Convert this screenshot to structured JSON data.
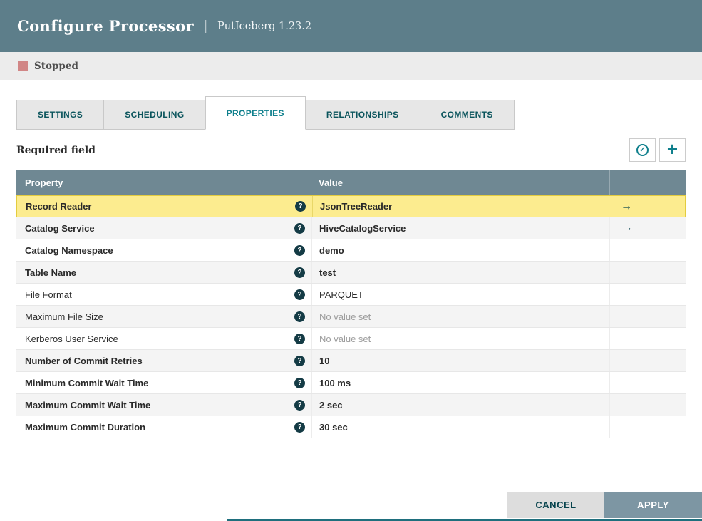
{
  "header": {
    "title": "Configure Processor",
    "separator": "|",
    "subtitle": "PutIceberg 1.23.2"
  },
  "status": {
    "label": "Stopped"
  },
  "tabs": [
    {
      "label": "SETTINGS",
      "active": false
    },
    {
      "label": "SCHEDULING",
      "active": false
    },
    {
      "label": "PROPERTIES",
      "active": true
    },
    {
      "label": "RELATIONSHIPS",
      "active": false
    },
    {
      "label": "COMMENTS",
      "active": false
    }
  ],
  "toolbar": {
    "required_label": "Required field"
  },
  "icons": {
    "help": "?",
    "go_to_service": "→",
    "verify_check": "✓",
    "add_plus": "+"
  },
  "table": {
    "columns": [
      "Property",
      "Value"
    ],
    "rows": [
      {
        "property": "Record Reader",
        "value": "JsonTreeReader",
        "required": true,
        "value_set": true,
        "has_link": true,
        "selected": true
      },
      {
        "property": "Catalog Service",
        "value": "HiveCatalogService",
        "required": true,
        "value_set": true,
        "has_link": true,
        "selected": false
      },
      {
        "property": "Catalog Namespace",
        "value": "demo",
        "required": true,
        "value_set": true,
        "has_link": false,
        "selected": false
      },
      {
        "property": "Table Name",
        "value": "test",
        "required": true,
        "value_set": true,
        "has_link": false,
        "selected": false
      },
      {
        "property": "File Format",
        "value": "PARQUET",
        "required": false,
        "value_set": true,
        "has_link": false,
        "selected": false
      },
      {
        "property": "Maximum File Size",
        "value": "No value set",
        "required": false,
        "value_set": false,
        "has_link": false,
        "selected": false
      },
      {
        "property": "Kerberos User Service",
        "value": "No value set",
        "required": false,
        "value_set": false,
        "has_link": false,
        "selected": false
      },
      {
        "property": "Number of Commit Retries",
        "value": "10",
        "required": true,
        "value_set": true,
        "has_link": false,
        "selected": false
      },
      {
        "property": "Minimum Commit Wait Time",
        "value": "100 ms",
        "required": true,
        "value_set": true,
        "has_link": false,
        "selected": false
      },
      {
        "property": "Maximum Commit Wait Time",
        "value": "2 sec",
        "required": true,
        "value_set": true,
        "has_link": false,
        "selected": false
      },
      {
        "property": "Maximum Commit Duration",
        "value": "30 sec",
        "required": true,
        "value_set": true,
        "has_link": false,
        "selected": false
      }
    ]
  },
  "footer": {
    "cancel_label": "CANCEL",
    "apply_label": "APPLY"
  },
  "colors": {
    "header_bg": "#5d7e8a",
    "table_header_bg": "#6f8893",
    "stopped_color": "#d18686",
    "accent_teal": "#0e7f8c",
    "dark_teal": "#07434d",
    "selected_row_bg": "#fcec8f",
    "selected_row_border": "#e3cc3f",
    "apply_bg": "#7d96a3",
    "help_icon_color": "#143b45"
  }
}
